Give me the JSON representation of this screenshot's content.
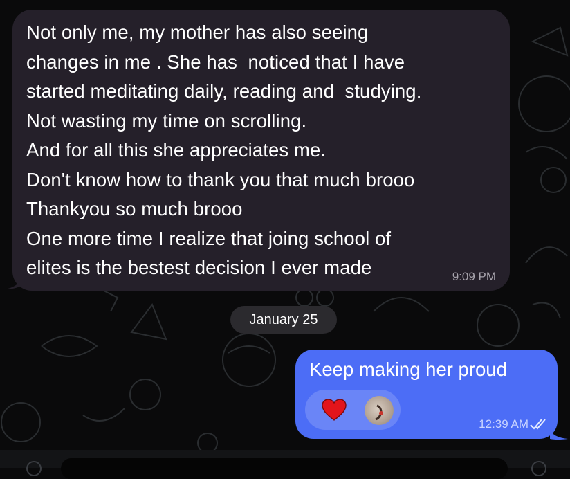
{
  "chat": {
    "incoming": {
      "text": "Not only me, my mother has also seeing\nchanges in me . She has  noticed that I have\nstarted meditating daily, reading and  studying.\nNot wasting my time on scrolling.\nAnd for all this she appreciates me.\nDon't know how to thank you that much brooo\nThankyou so much brooo\nOne more time I realize that joing school of\nelites is the bestest decision I ever made",
      "time": "9:09 PM"
    },
    "date_separator": "January 25",
    "outgoing": {
      "text": "Keep making her proud",
      "time": "12:39 AM",
      "status": "read",
      "reactions": [
        {
          "icon": "heart-icon",
          "color": "#e3141b"
        }
      ]
    }
  },
  "colors": {
    "background": "#0a0a0b",
    "incoming_bubble": "#25202a",
    "outgoing_bubble": "#4c6df6",
    "reaction_pill": "#6a85f7",
    "date_pill": "#2b2a2e"
  }
}
